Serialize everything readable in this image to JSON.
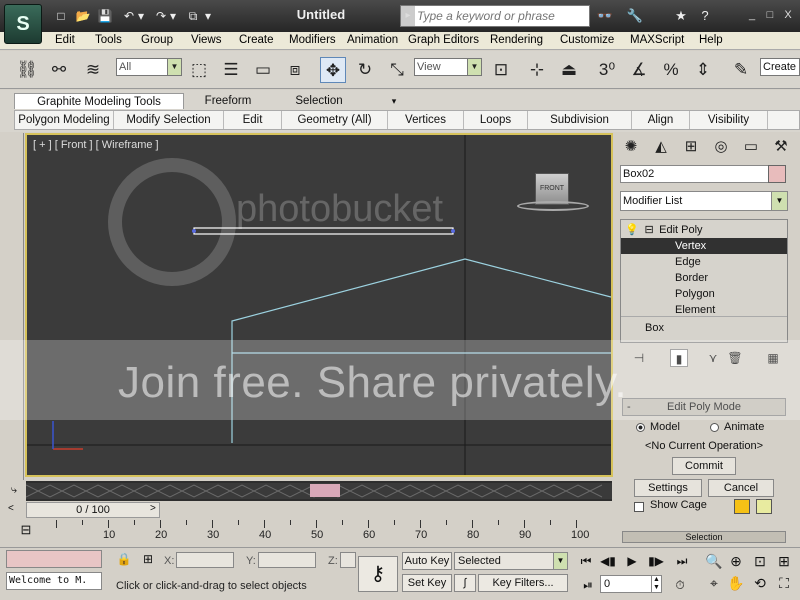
{
  "app": {
    "logo_glyph": "S",
    "document_title": "Untitled",
    "quick_access": [
      "□",
      "📂",
      "💾",
      "↶",
      "▾",
      "↷",
      "▾",
      "⧉",
      "▾"
    ],
    "search_placeholder": "Type a keyword or phrase",
    "info_center_icons": [
      "👓",
      "🔧",
      "★",
      "?"
    ],
    "window_controls": [
      "_",
      "□",
      "X"
    ]
  },
  "menu": [
    "Edit",
    "Tools",
    "Group",
    "Views",
    "Create",
    "Modifiers",
    "Animation",
    "Graph Editors",
    "Rendering",
    "Customize",
    "MAXScript",
    "Help"
  ],
  "main_toolbar": {
    "selection_filter": "All",
    "ref_coord": "View",
    "named_selection": "Create"
  },
  "ribbon": {
    "tabs": [
      "Graphite Modeling Tools",
      "Freeform",
      "Selection"
    ],
    "tab_more": "▾",
    "panels": [
      "Polygon Modeling",
      "Modify Selection",
      "Edit",
      "Geometry (All)",
      "Vertices",
      "Loops",
      "Subdivision",
      "Align",
      "Visibility"
    ]
  },
  "viewport": {
    "label": "[ + ] [ Front ] [ Wireframe ]",
    "viewcube_face": "FRONT",
    "grid_color": "#1a1a1a",
    "shape_color": "#9cd2e0",
    "selected_color": "#ffffff"
  },
  "command_panel": {
    "object_name": "Box02",
    "object_color": "#e8bcbc",
    "modifier_list": "Modifier List",
    "stack": {
      "modifier": "Edit Poly",
      "expand_glyph": "⊟",
      "sub_objects": [
        "Vertex",
        "Edge",
        "Border",
        "Polygon",
        "Element"
      ],
      "selected_index": 0,
      "base": "Box"
    },
    "edit_poly_mode": {
      "title": "Edit Poly Mode",
      "collapse_glyph": "-",
      "mode_model": "Model",
      "mode_animate": "Animate",
      "current_op": "<No Current Operation>",
      "commit": "Commit",
      "settings": "Settings",
      "cancel": "Cancel",
      "show_cage": "Show Cage",
      "cage_color_1": "#f5c116",
      "cage_color_2": "#e8eba0"
    },
    "selection_rollout": "Selection"
  },
  "timeline": {
    "slider": "0 / 100",
    "ticks": [
      10,
      20,
      30,
      40,
      50,
      60,
      70,
      80,
      90,
      100
    ]
  },
  "status": {
    "listener_output": "Welcome to M.",
    "x_label": "X:",
    "y_label": "Y:",
    "z_label": "Z:",
    "prompt": "Click or click-and-drag to select objects",
    "auto_key": "Auto Key",
    "set_key": "Set Key",
    "key_mode": "Selected",
    "key_filters": "Key Filters...",
    "current_frame": "0"
  },
  "watermark": {
    "brand": "photobucket",
    "slogan": "Join free. Share privately."
  }
}
